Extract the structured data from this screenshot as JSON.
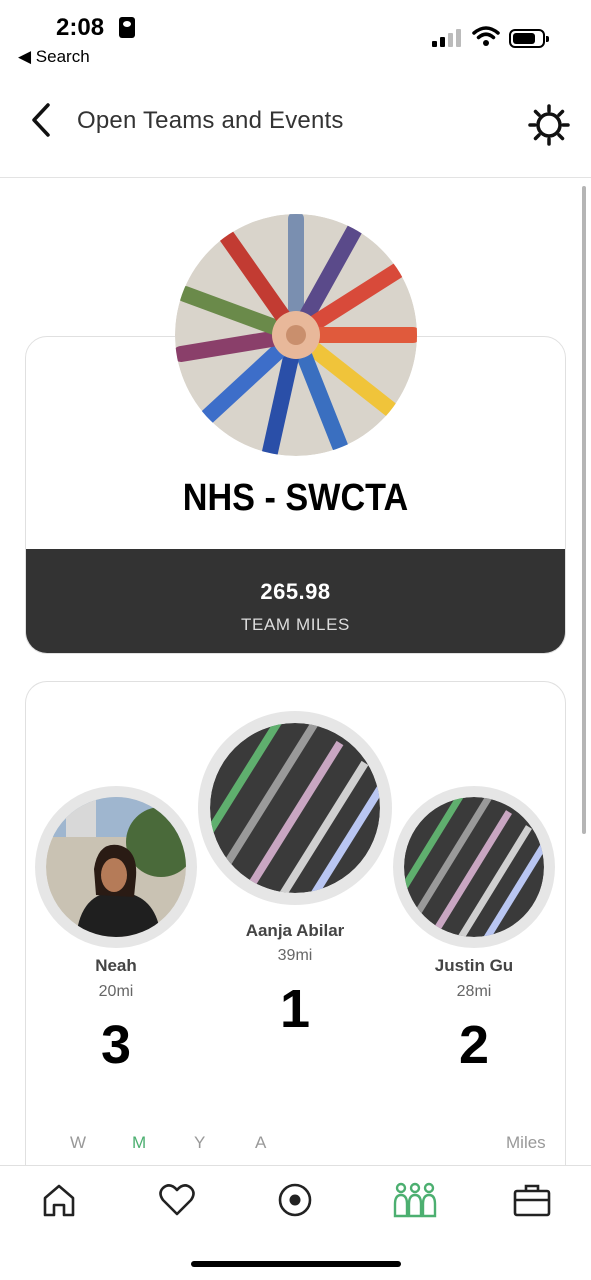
{
  "status_bar": {
    "time": "2:08",
    "back_app": "◀ Search"
  },
  "header": {
    "title": "Open Teams and Events"
  },
  "team": {
    "name": "NHS - SWCTA",
    "miles_value": "265.98",
    "miles_label": "TEAM MILES"
  },
  "leaderboard": {
    "podium": [
      {
        "name": "Aanja Abilar",
        "miles": "39mi",
        "rank": "1"
      },
      {
        "name": "Justin Gu",
        "miles": "28mi",
        "rank": "2"
      },
      {
        "name": "Neah",
        "miles": "20mi",
        "rank": "3"
      }
    ],
    "filters": [
      {
        "label": "W",
        "active": false
      },
      {
        "label": "M",
        "active": true
      },
      {
        "label": "Y",
        "active": false
      },
      {
        "label": "A",
        "active": false
      }
    ],
    "units": "Miles"
  },
  "tabs": [
    {
      "icon": "home-icon"
    },
    {
      "icon": "heart-icon"
    },
    {
      "icon": "record-icon"
    },
    {
      "icon": "teams-icon",
      "active": true
    },
    {
      "icon": "briefcase-icon"
    }
  ],
  "colors": {
    "accent": "#4caf70",
    "dark_band": "#333333"
  }
}
